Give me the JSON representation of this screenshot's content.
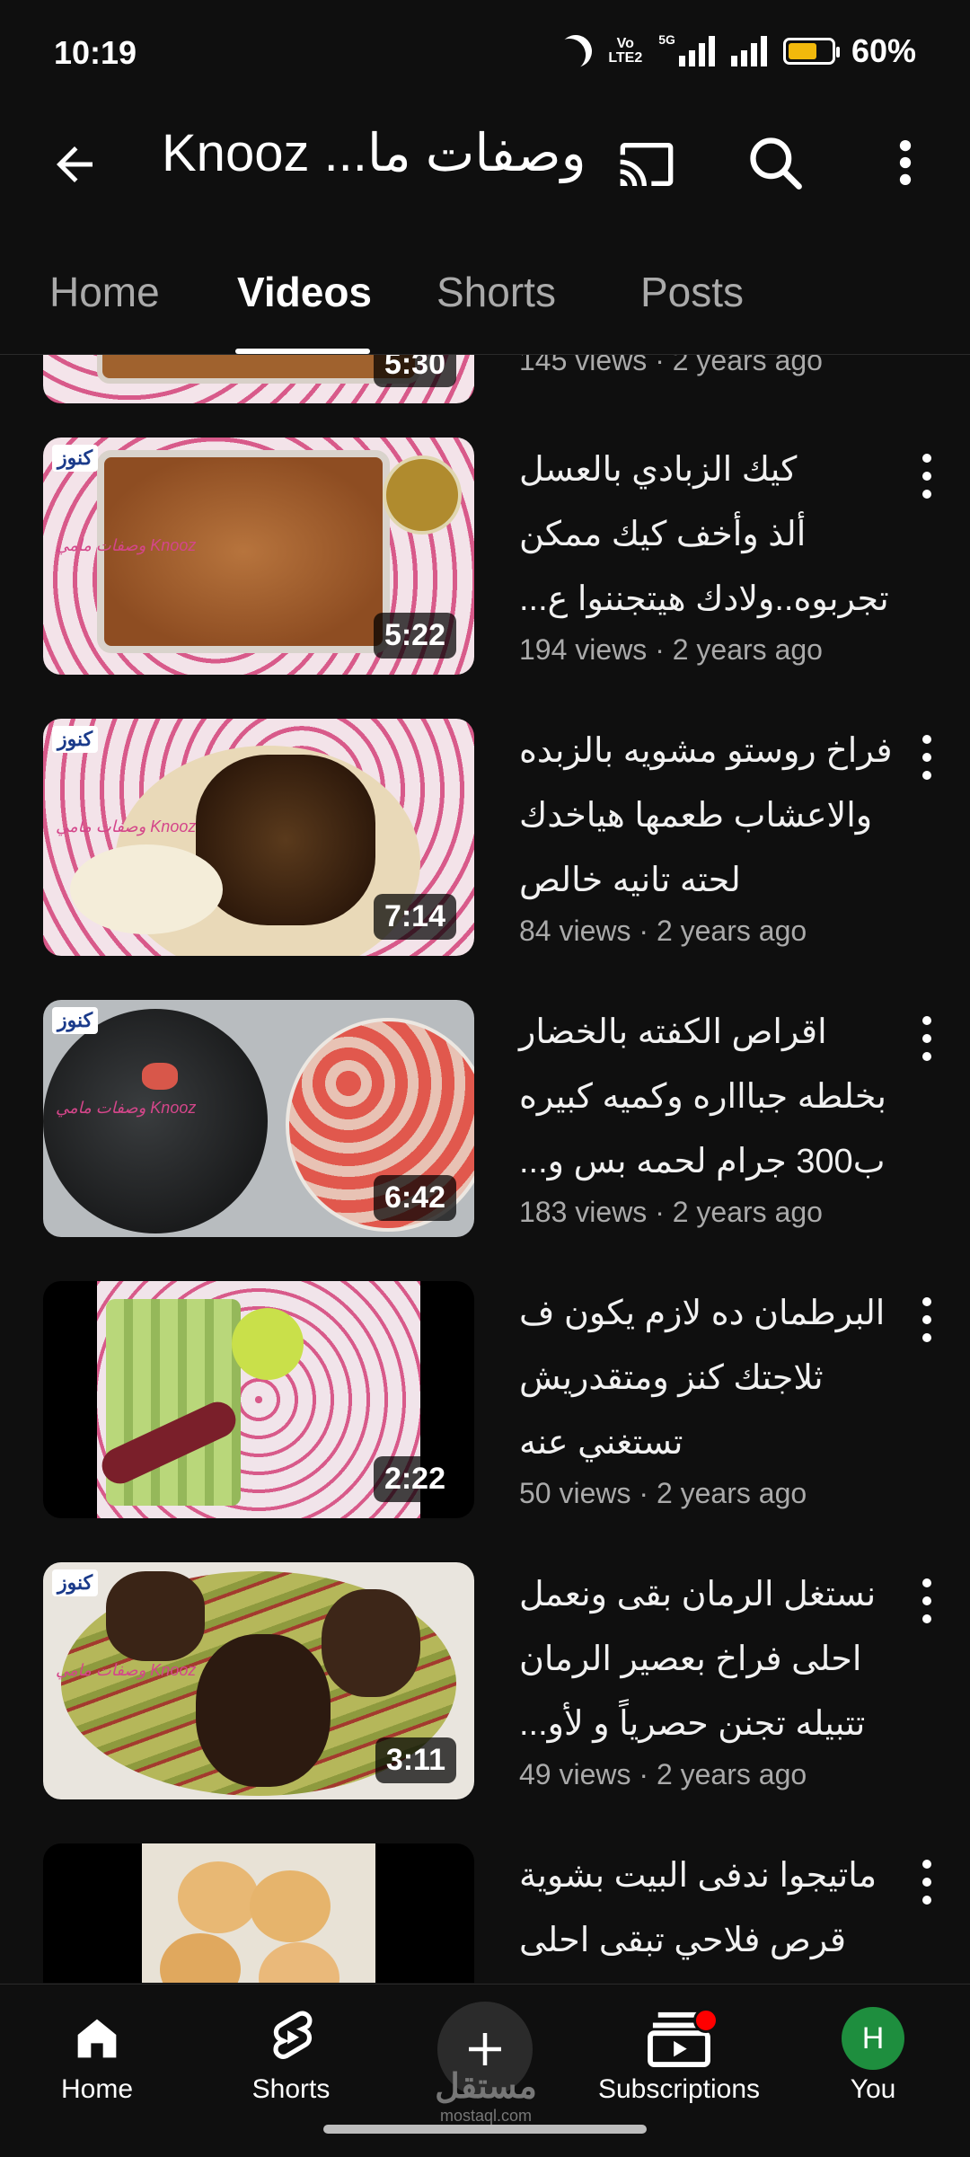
{
  "status_bar": {
    "time": "10:19",
    "network": "5G",
    "volte": "Vo LTE2",
    "battery": "60%"
  },
  "app_bar": {
    "title": "Knooz ...وصفات ما",
    "icons": [
      "back-icon",
      "cast-icon",
      "search-icon",
      "more-icon"
    ]
  },
  "tabs": [
    {
      "label": "Home",
      "active": false
    },
    {
      "label": "Videos",
      "active": true
    },
    {
      "label": "Shorts",
      "active": false
    },
    {
      "label": "Posts",
      "active": false
    }
  ],
  "videos": [
    {
      "title_lines": [],
      "meta": "145 views · 2 years ago",
      "duration": "5:30"
    },
    {
      "title_lines": [
        "كيك الزبادي بالعسل",
        "ألذ وأخف كيك ممكن",
        "تجربوه..ولادك هيتجننوا ع..."
      ],
      "meta": "194 views · 2 years ago",
      "duration": "5:22"
    },
    {
      "title_lines": [
        "فراخ روستو مشويه بالزبده",
        "والاعشاب طعمها هياخدك",
        "لحته تانيه خالص"
      ],
      "meta": "84 views · 2 years ago",
      "duration": "7:14"
    },
    {
      "title_lines": [
        "اقراص الكفته بالخضار",
        "بخلطه جباااره وكميه كبيره",
        "ب300 جرام لحمه بس و..."
      ],
      "meta": "183 views · 2 years ago",
      "duration": "6:42"
    },
    {
      "title_lines": [
        "البرطمان ده لازم يكون ف",
        "ثلاجتك كنز ومتقدريش",
        "تستغني عنه"
      ],
      "meta": "50 views · 2 years ago",
      "duration": "2:22"
    },
    {
      "title_lines": [
        "نستغل الرمان بقى ونعمل",
        "احلى فراخ بعصير الرمان",
        "تتبيله تجنن حصرياً و لأو..."
      ],
      "meta": "49 views · 2 years ago",
      "duration": "3:11"
    },
    {
      "title_lines": [
        "ماتيجوا ندفى البيت بشوية",
        "قرص فلاحي تبقى احلى"
      ],
      "meta": "",
      "duration": ""
    }
  ],
  "thumb_badge": "كنوز",
  "thumb_watermark": "وصفات مامي Knooz",
  "bottom_nav": {
    "home": "Home",
    "shorts": "Shorts",
    "subscriptions": "Subscriptions",
    "you": "You",
    "avatar_letter": "H"
  },
  "watermark": {
    "text": "مستقل",
    "sub": "mostaql.com"
  },
  "colors": {
    "background": "#0f0f0f",
    "secondary_text": "#aaaaaa",
    "notification_dot": "#ff0000",
    "avatar": "#1e8e3e",
    "battery": "#f2b90c"
  }
}
